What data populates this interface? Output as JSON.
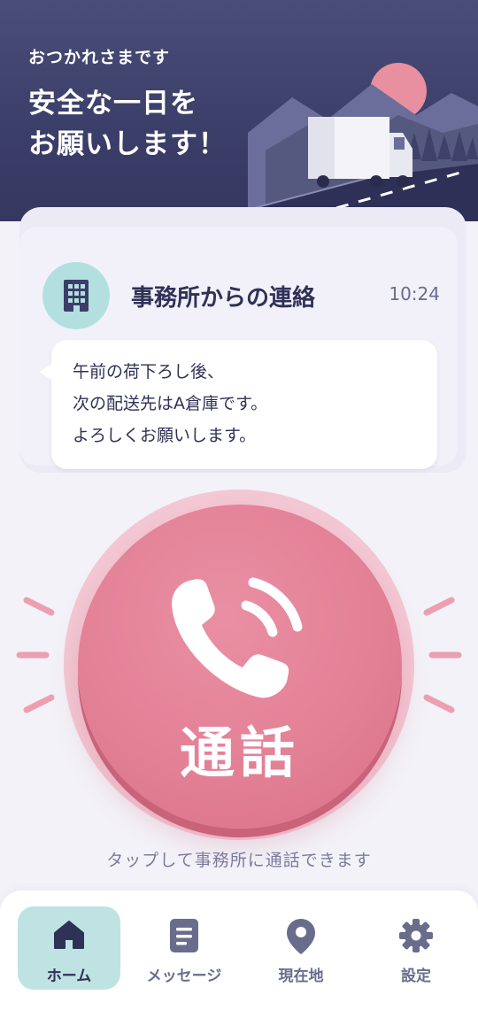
{
  "header": {
    "greeting": "おつかれさまです",
    "headline_line1": "安全な一日を",
    "headline_line2": "お願いします！"
  },
  "message_card": {
    "title": "事務所からの連絡",
    "time": "10:24",
    "icon": "building-icon",
    "body_lines": [
      "午前の荷下ろし後、",
      "次の配送先はA倉庫です。",
      "よろしくお願いします。"
    ]
  },
  "call": {
    "label": "通話",
    "icon": "phone-ringing-icon",
    "hint": "タップして事務所に通話できます"
  },
  "nav": {
    "items": [
      {
        "label": "ホーム",
        "icon": "home-icon",
        "active": true
      },
      {
        "label": "メッセージ",
        "icon": "document-icon",
        "active": false
      },
      {
        "label": "現在地",
        "icon": "location-pin-icon",
        "active": false
      },
      {
        "label": "設定",
        "icon": "gear-icon",
        "active": false
      }
    ]
  },
  "colors": {
    "header_bg": "#3b3e69",
    "accent_pink": "#e27f95",
    "accent_teal": "#b3e0df",
    "text_dark": "#2f3157"
  }
}
